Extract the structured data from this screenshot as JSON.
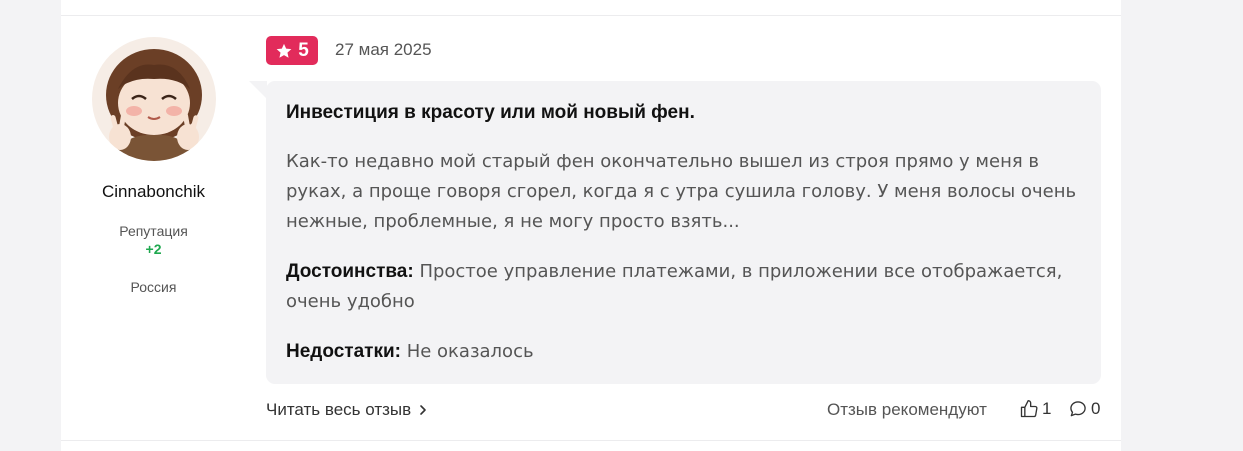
{
  "author": {
    "name": "Cinnabonchik",
    "reputation_label": "Репутация",
    "reputation_value": "+2",
    "country": "Россия"
  },
  "review": {
    "rating": "5",
    "date": "27 мая 2025",
    "title": "Инвестиция в красоту или мой новый фен.",
    "text": "Как-то недавно мой старый фен окончательно вышел из строя прямо у меня в руках, а проще говоря сгорел, когда я с утра сушила голову. У меня волосы очень нежные, проблемные, я не могу просто взять...",
    "pros_label": "Достоинства:",
    "pros_text": "Простое управление платежами, в приложении все отображается, очень удобно",
    "cons_label": "Недостатки:",
    "cons_text": "Не оказалось"
  },
  "footer": {
    "read_more": "Читать весь отзыв",
    "recommend_label": "Отзыв рекомендуют",
    "likes_count": "1",
    "comments_count": "0"
  },
  "icons": {
    "rating": "star-icon",
    "read_more": "chevron-right-icon",
    "likes": "thumbs-up-icon",
    "comments": "comment-bubble-icon"
  },
  "colors": {
    "rating_badge": "#e22b5b",
    "reputation_positive": "#1fa84f",
    "bubble_bg": "#f3f3f5"
  }
}
